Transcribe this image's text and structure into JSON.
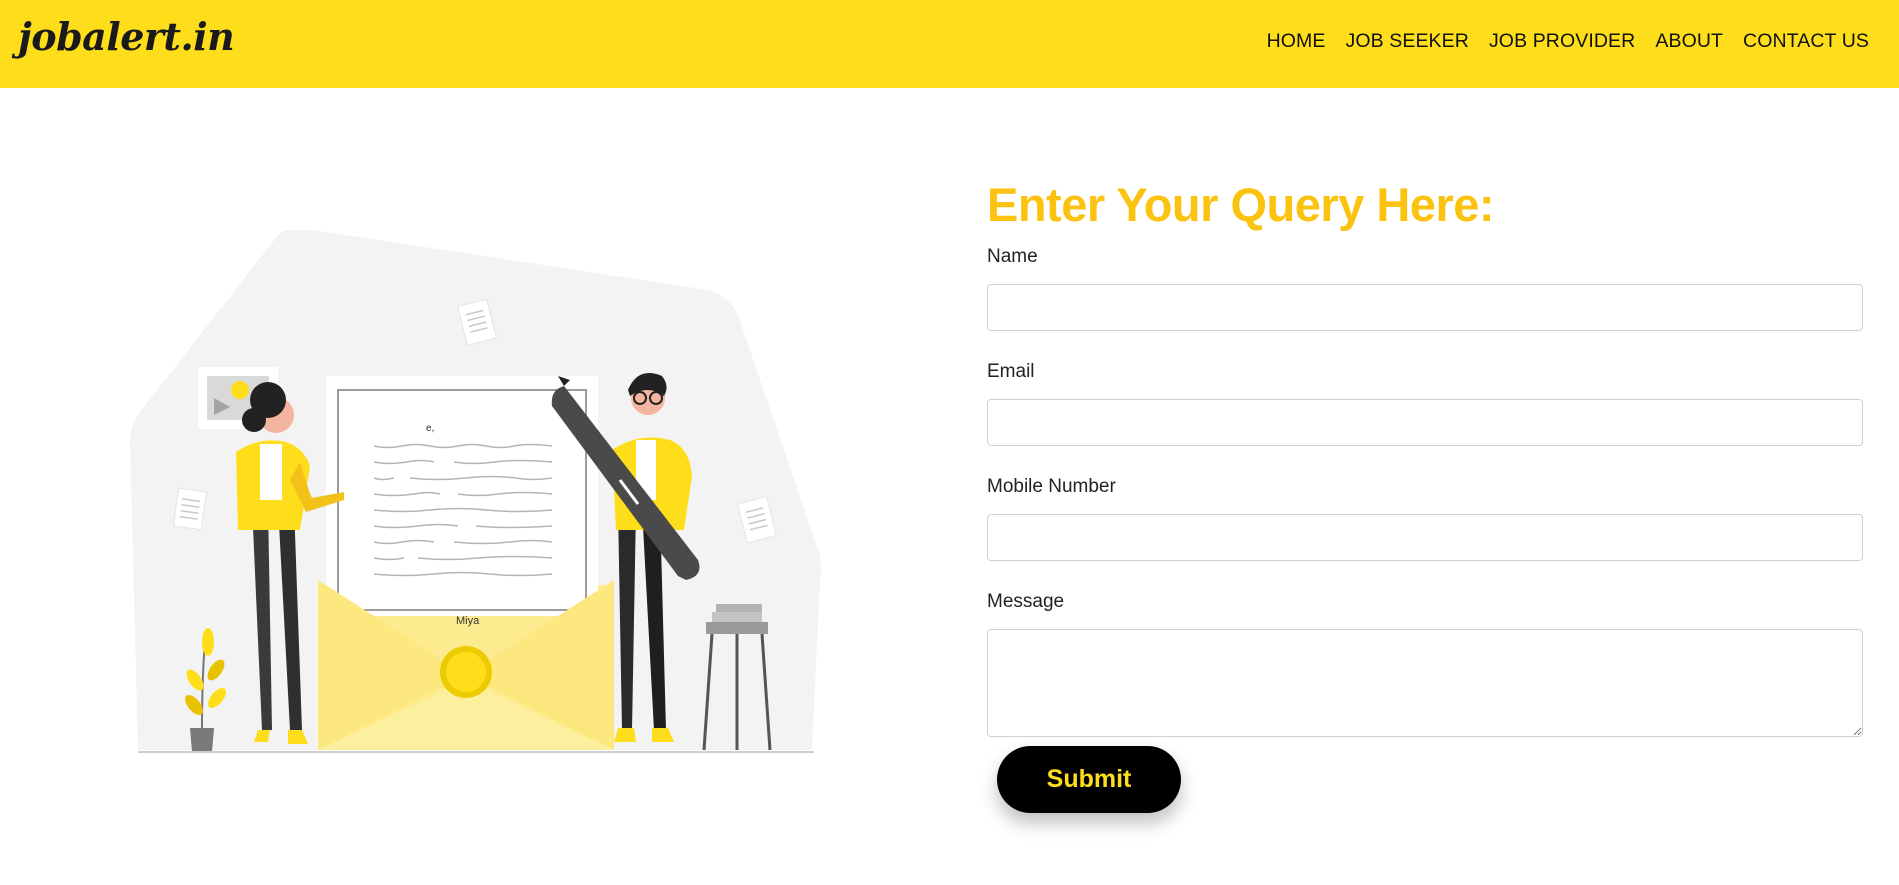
{
  "brand": {
    "name": "jobalert.in"
  },
  "nav": {
    "items": [
      {
        "label": "HOME"
      },
      {
        "label": "JOB SEEKER"
      },
      {
        "label": "JOB PROVIDER"
      },
      {
        "label": "ABOUT"
      },
      {
        "label": "CONTACT US"
      }
    ]
  },
  "illustration": {
    "letter_heading": "e,",
    "letter_signature": "Miya"
  },
  "form": {
    "title": "Enter Your Query Here:",
    "fields": {
      "name": {
        "label": "Name",
        "value": "",
        "placeholder": ""
      },
      "email": {
        "label": "Email",
        "value": "",
        "placeholder": ""
      },
      "mobile": {
        "label": "Mobile Number",
        "value": "",
        "placeholder": ""
      },
      "message": {
        "label": "Message",
        "value": "",
        "placeholder": ""
      }
    },
    "submit_label": "Submit"
  },
  "colors": {
    "navbar": "#fede1b",
    "title": "#fbc30f",
    "button_bg": "#000000",
    "button_text": "#fede1b"
  }
}
